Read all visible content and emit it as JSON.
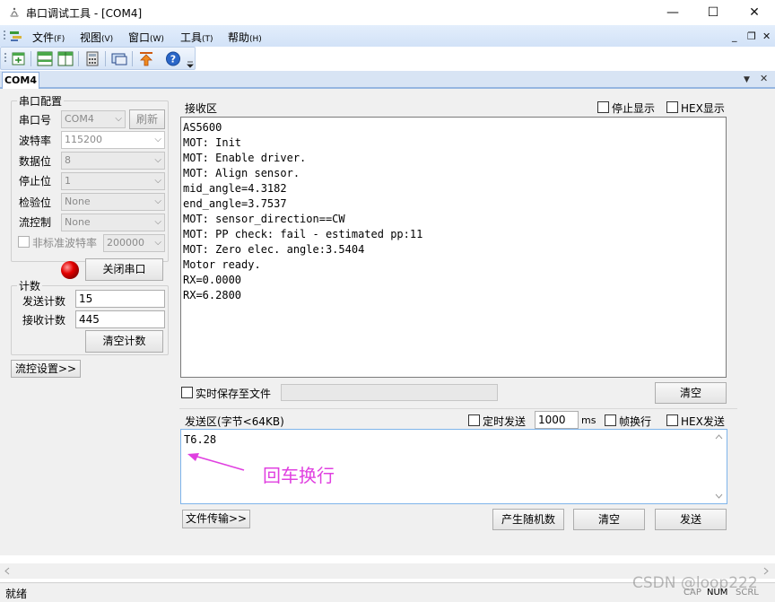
{
  "window": {
    "title": "串口调试工具 - [COM4]",
    "minimize": "—",
    "maximize": "☐",
    "close": "✕"
  },
  "menu": {
    "items": [
      {
        "label": "文件",
        "key": "(F)"
      },
      {
        "label": "视图",
        "key": "(V)"
      },
      {
        "label": "窗口",
        "key": "(W)"
      },
      {
        "label": "工具",
        "key": "(T)"
      },
      {
        "label": "帮助",
        "key": "(H)"
      }
    ],
    "mdi_minimize": "_",
    "mdi_restore": "❐",
    "mdi_close": "✕"
  },
  "toolbar": {
    "icons": [
      "new-window-icon",
      "split-horizontal-icon",
      "split-vertical-icon",
      "calculator-icon",
      "screen-icon",
      "upload-icon",
      "help-icon"
    ]
  },
  "tab": {
    "label": "COM4",
    "dropdown": "▼",
    "close": "✕"
  },
  "serial_config": {
    "title": "串口配置",
    "port_label": "串口号",
    "port_value": "COM4",
    "refresh_label": "刷新",
    "baud_label": "波特率",
    "baud_value": "115200",
    "data_bits_label": "数据位",
    "data_bits_value": "8",
    "stop_bits_label": "停止位",
    "stop_bits_value": "1",
    "parity_label": "检验位",
    "parity_value": "None",
    "flow_label": "流控制",
    "flow_value": "None",
    "nonstd_label": "非标准波特率",
    "nonstd_value": "200000",
    "close_port_label": "关闭串口",
    "status_color": "#e30000"
  },
  "counter": {
    "title": "计数",
    "send_label": "发送计数",
    "send_value": "15",
    "recv_label": "接收计数",
    "recv_value": "445",
    "clear_label": "清空计数"
  },
  "flow_settings_label": "流控设置>>",
  "receive": {
    "title": "接收区",
    "stop_display_label": "停止显示",
    "hex_display_label": "HEX显示",
    "lines": [
      "AS5600",
      "MOT: Init",
      "MOT: Enable driver.",
      "MOT: Align sensor.",
      "mid_angle=4.3182",
      "end_angle=3.7537",
      "MOT: sensor_direction==CW",
      "MOT: PP check: fail - estimated pp:11",
      "MOT: Zero elec. angle:3.5404",
      "Motor ready.",
      "RX=0.0000",
      "RX=6.2800"
    ],
    "save_to_file_label": "实时保存至文件",
    "clear_label": "清空"
  },
  "send": {
    "title": "发送区(字节<64KB)",
    "timed_label": "定时发送",
    "interval_value": "1000",
    "interval_unit": "ms",
    "newline_label": "帧换行",
    "hex_send_label": "HEX发送",
    "content": "T6.28",
    "annotation": "回车换行",
    "annotation_color": "#e040e0",
    "file_transfer_label": "文件传输>>",
    "random_label": "产生随机数",
    "clear_label": "清空",
    "send_label": "发送"
  },
  "status": {
    "ready": "就绪",
    "watermark": "CSDN @loop222",
    "cap": "CAP",
    "num": "NUM",
    "scrl": "SCRL"
  }
}
